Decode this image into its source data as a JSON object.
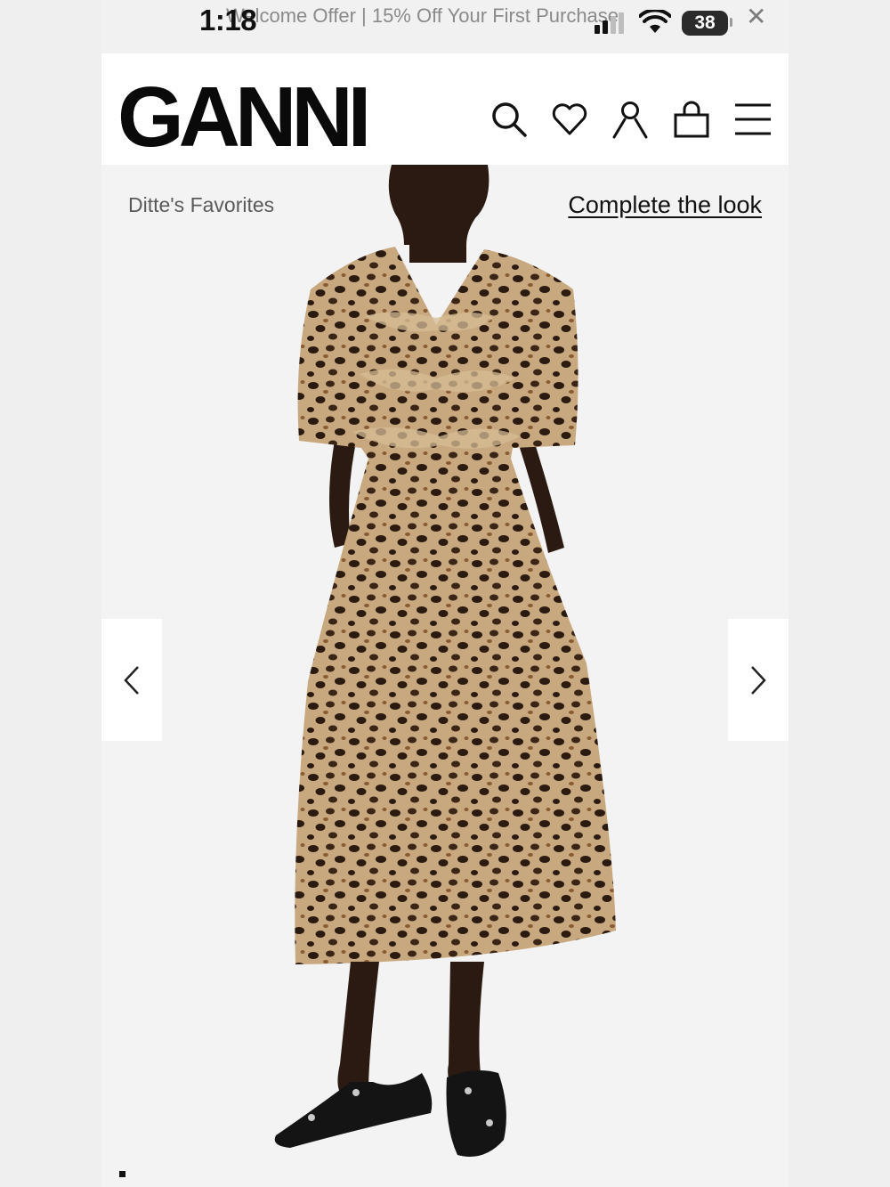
{
  "status_bar": {
    "time": "1:18",
    "promo": "Welcome Offer | 15% Off Your First Purchase",
    "battery": "38",
    "close_symbol": "✕"
  },
  "header": {
    "logo": "GANNI",
    "icons": [
      "search-icon",
      "heart-icon",
      "account-icon",
      "bag-icon",
      "menu-icon"
    ]
  },
  "product": {
    "collection_label": "Ditte's Favorites",
    "complete_look_link": "Complete the look",
    "image_subject": "leopard-print-midi-dress",
    "prev_label": "‹",
    "next_label": "›"
  },
  "colors": {
    "leopard_base": "#b8946a",
    "leopard_spot": "#2b1a10",
    "background": "#f3f3f3"
  }
}
